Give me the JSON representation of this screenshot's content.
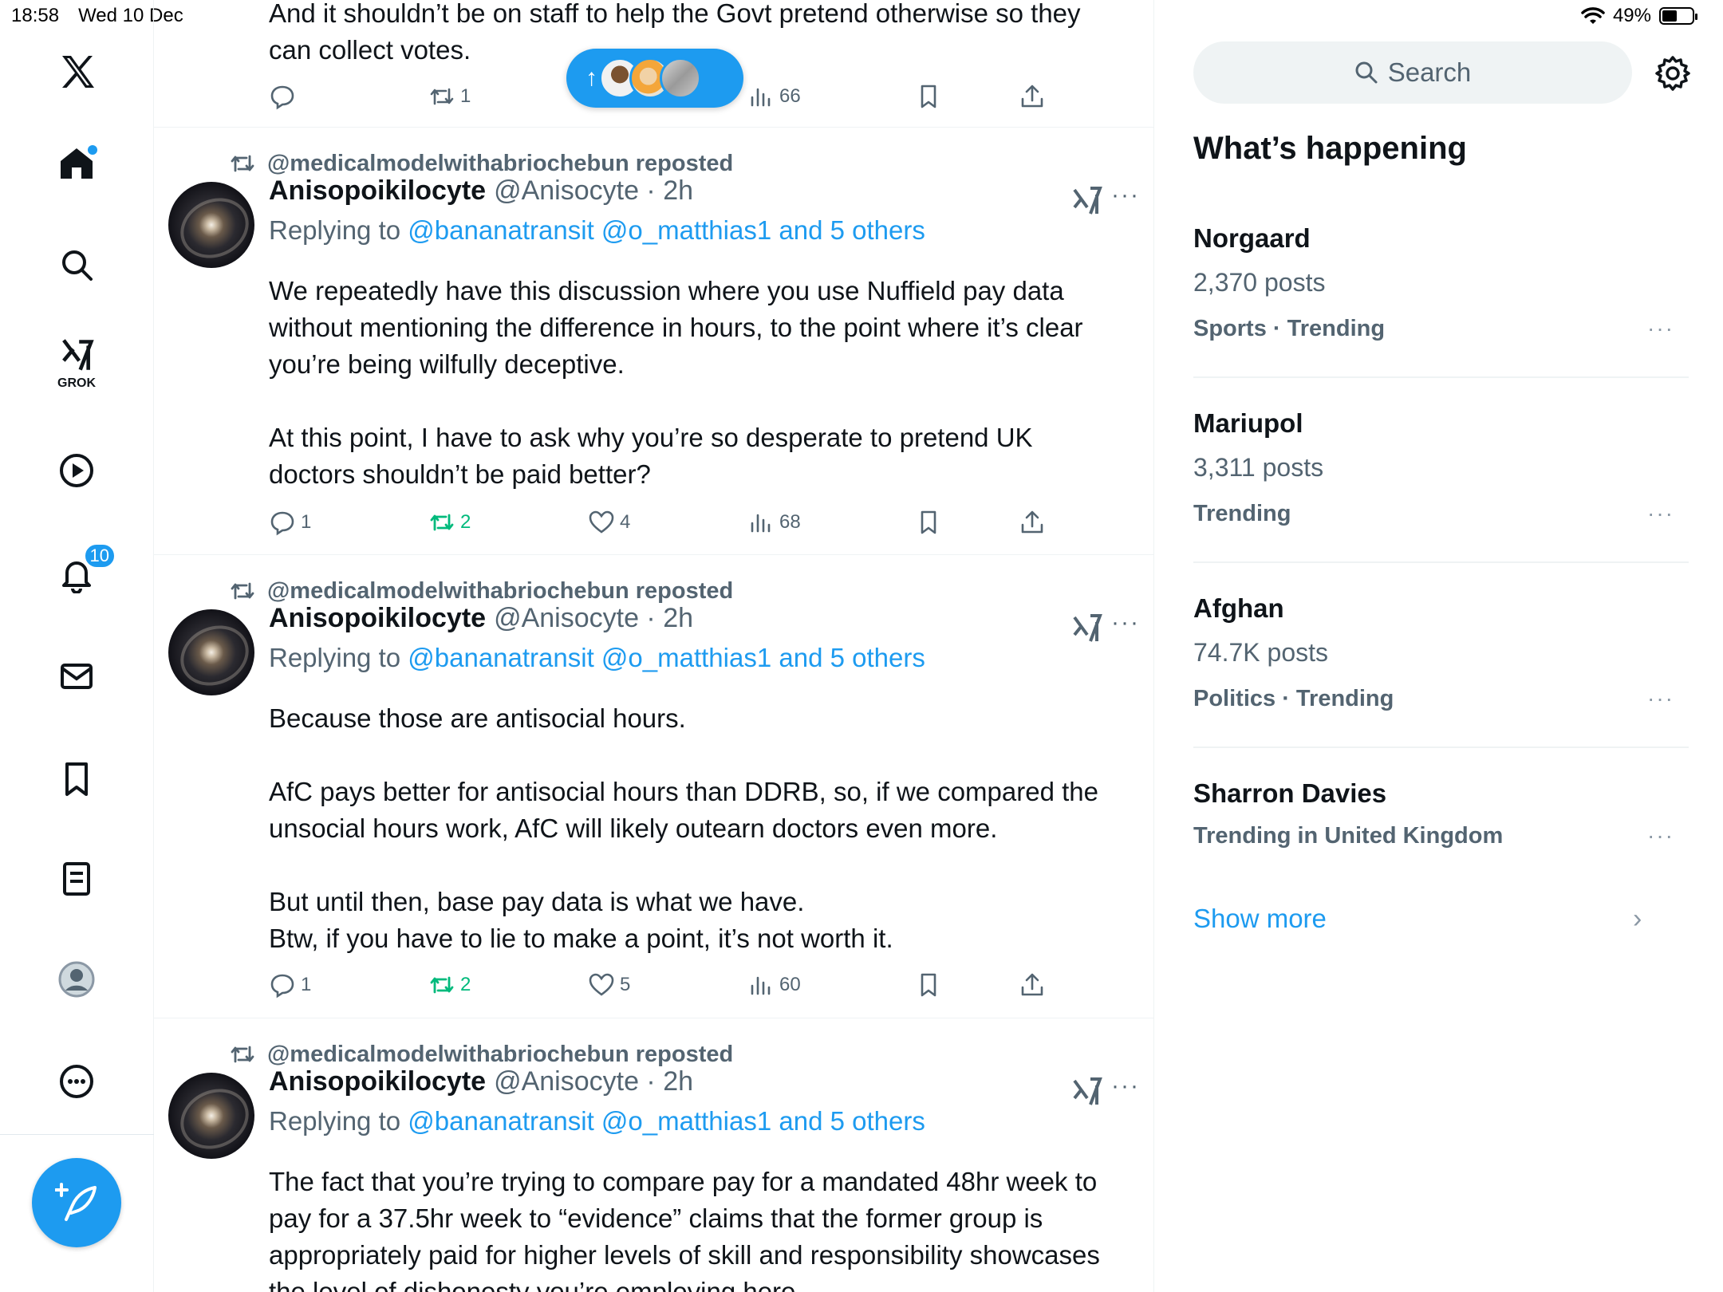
{
  "status_bar": {
    "time": "18:58",
    "date": "Wed 10 Dec",
    "battery": "49%",
    "battery_level": 0.49
  },
  "nav": {
    "grok_label": "GROK",
    "notifications_count": "10"
  },
  "top_post": {
    "text": "And it shouldn’t be on staff to help the Govt pretend otherwise so they\ncan collect votes.",
    "reposts": "1",
    "views": "66"
  },
  "posts": [
    {
      "reposted_by": "@medicalmodelwithabriochebun reposted",
      "name": "Anisopoikilocyte",
      "handle": "@Anisocyte · 2h",
      "replying_prefix": "Replying to ",
      "replying_to": "@bananatransit @o_matthias1 and 5 others",
      "text": "We repeatedly have this discussion where you use Nuffield pay data\nwithout mentioning the difference in hours, to the point where it’s clear\nyou’re being wilfully deceptive.\n\nAt this point, I have to ask why you’re so desperate to pretend UK\ndoctors shouldn’t be paid better?",
      "replies": "1",
      "reposts": "2",
      "likes": "4",
      "views": "68"
    },
    {
      "reposted_by": "@medicalmodelwithabriochebun reposted",
      "name": "Anisopoikilocyte",
      "handle": "@Anisocyte · 2h",
      "replying_prefix": "Replying to ",
      "replying_to": "@bananatransit @o_matthias1 and 5 others",
      "text": "Because those are antisocial hours.\n\nAfC pays better for antisocial hours than DDRB, so, if we compared the\nunsocial hours work, AfC will likely outearn doctors even more.\n\nBut until then, base pay data is what we have.\nBtw, if you have to lie to make a point, it’s not worth it.",
      "replies": "1",
      "reposts": "2",
      "likes": "5",
      "views": "60"
    },
    {
      "reposted_by": "@medicalmodelwithabriochebun reposted",
      "name": "Anisopoikilocyte",
      "handle": "@Anisocyte · 2h",
      "replying_prefix": "Replying to ",
      "replying_to": "@bananatransit @o_matthias1 and 5 others",
      "text": "The fact that you’re trying to compare pay for a mandated 48hr week to\npay for a 37.5hr week to “evidence” claims that the former group is\nappropriately paid for higher levels of skill and responsibility showcases\nthe level of dishonesty you’re employing here."
    }
  ],
  "sidebar": {
    "search_placeholder": "Search",
    "whats_happening": "What’s happening",
    "trends": [
      {
        "name": "Norgaard",
        "count": "2,370 posts",
        "category": "Sports · Trending"
      },
      {
        "name": "Mariupol",
        "count": "3,311 posts",
        "category": "Trending"
      },
      {
        "name": "Afghan",
        "count": "74.7K posts",
        "category": "Politics · Trending"
      },
      {
        "name": "Sharron Davies",
        "count": "",
        "category": "Trending in United Kingdom"
      }
    ],
    "show_more": "Show more"
  },
  "colors": {
    "accent": "#1d9bf0",
    "repost_green": "#00ba7c",
    "muted": "#536471"
  }
}
